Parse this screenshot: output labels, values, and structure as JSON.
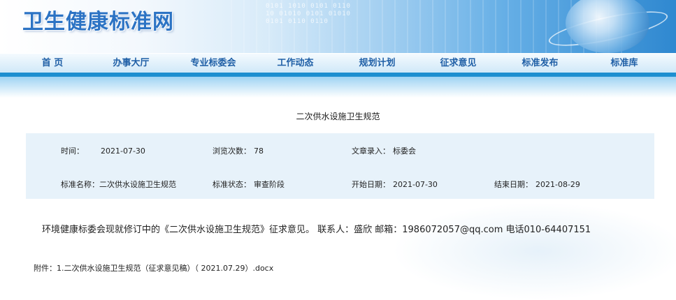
{
  "site": {
    "title": "卫生健康标准网"
  },
  "banner": {
    "binary_text": "0101 1010 0101 0110\n10 01010 0101 01010\n0101 0110 0110"
  },
  "nav": {
    "items": [
      {
        "label": "首  页"
      },
      {
        "label": "办事大厅"
      },
      {
        "label": "专业标委会"
      },
      {
        "label": "工作动态"
      },
      {
        "label": "规划计划"
      },
      {
        "label": "征求意见"
      },
      {
        "label": "标准发布"
      },
      {
        "label": "标准库"
      }
    ]
  },
  "article": {
    "title": "二次供水设施卫生规范",
    "info": {
      "time_label": "时间：",
      "time_value": "2021-07-30",
      "views_label": "浏览次数：",
      "views_value": "78",
      "entry_label": "文章录入：",
      "entry_value": "标委会",
      "std_name_label": "标准名称：",
      "std_name_value": "二次供水设施卫生规范",
      "status_label": "标准状态：",
      "status_value": "审查阶段",
      "start_label": "开始日期：",
      "start_value": "2021-07-30",
      "end_label": "结束日期：",
      "end_value": "2021-08-29"
    },
    "body": "环境健康标委会现就修订中的《二次供水设施卫生规范》征求意见。 联系人：盛欣 邮箱：1986072057@qq.com 电话010-64407151",
    "attachment_label": "附件：",
    "attachment_file": "1.二次供水设施卫生规范（征求意见稿）（ 2021.07.29）.docx"
  }
}
